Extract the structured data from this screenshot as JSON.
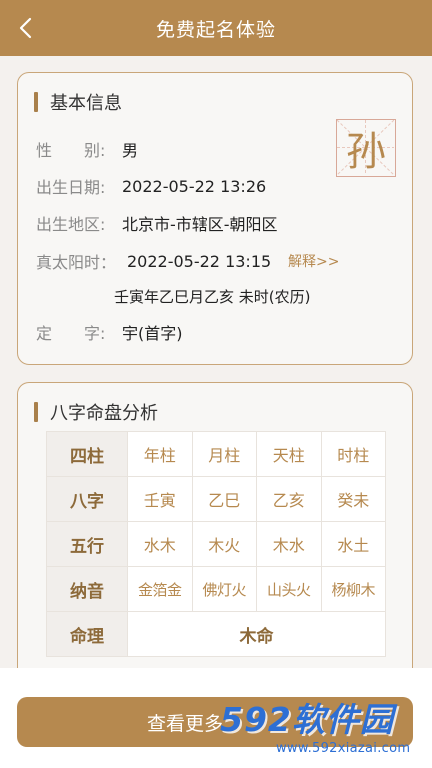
{
  "header": {
    "title": "免费起名体验"
  },
  "basic_info": {
    "title": "基本信息",
    "surname": "孙",
    "rows": [
      {
        "label": "性　　别:",
        "value": "男"
      },
      {
        "label": "出生日期:",
        "value": "2022-05-22 13:26"
      },
      {
        "label": "出生地区:",
        "value": "北京市-市辖区-朝阳区"
      },
      {
        "label": "真太阳时：",
        "value": "2022-05-22 13:15"
      },
      {
        "label": "定　　字:",
        "value": "宇(首字)"
      }
    ],
    "explain_link": "解释>>",
    "lunar_text": "壬寅年乙巳月乙亥 未时(农历)"
  },
  "bazi": {
    "title": "八字命盘分析",
    "rows": [
      {
        "header": "四柱",
        "cells": [
          "年柱",
          "月柱",
          "天柱",
          "时柱"
        ]
      },
      {
        "header": "八字",
        "cells": [
          "壬寅",
          "乙巳",
          "乙亥",
          "癸未"
        ]
      },
      {
        "header": "五行",
        "cells": [
          "水木",
          "木火",
          "木水",
          "水土"
        ]
      },
      {
        "header": "纳音",
        "cells": [
          "金箔金",
          "佛灯火",
          "山头火",
          "杨柳木"
        ]
      }
    ],
    "mingli": {
      "header": "命理",
      "value": "木命"
    }
  },
  "cta": {
    "label": "查看更多"
  },
  "watermark": {
    "text": "592软件园",
    "url": "www.592xiazai.com"
  },
  "colors": {
    "brand": "#b6894f",
    "background": "#f4f1ee",
    "border": "#c9a679"
  }
}
